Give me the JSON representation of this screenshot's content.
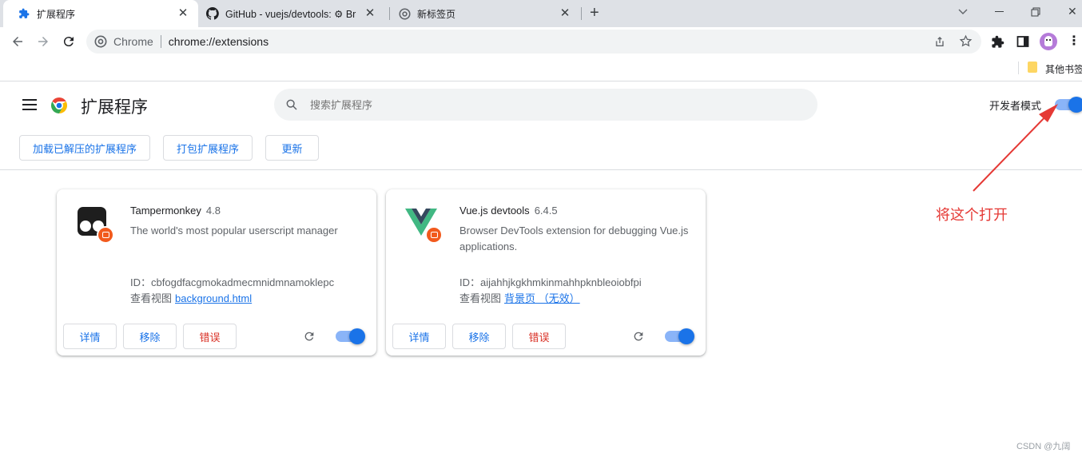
{
  "tabs": [
    {
      "title": "扩展程序",
      "icon": "puzzle-icon",
      "active": true
    },
    {
      "title": "GitHub - vuejs/devtools: ⚙ Br",
      "icon": "github-icon",
      "active": false
    },
    {
      "title": "新标签页",
      "icon": "chrome-icon",
      "active": false
    }
  ],
  "omnibox": {
    "site_label": "Chrome",
    "url": "chrome://extensions"
  },
  "bookmarks": {
    "other_label": "其他书签"
  },
  "header": {
    "title": "扩展程序",
    "search_placeholder": "搜索扩展程序",
    "dev_mode_label": "开发者模式",
    "dev_mode_on": true
  },
  "actions": {
    "load_unpacked": "加载已解压的扩展程序",
    "pack": "打包扩展程序",
    "update": "更新"
  },
  "extensions": [
    {
      "name": "Tampermonkey",
      "version": "4.8",
      "description": "The world's most popular userscript manager",
      "id_label": "ID：",
      "id": "cbfogdfacgmokadmecmnidmnamoklepc",
      "view_label": "查看视图",
      "view_link": "background.html",
      "details": "详情",
      "remove": "移除",
      "errors": "错误",
      "enabled": true
    },
    {
      "name": "Vue.js devtools",
      "version": "6.4.5",
      "description": "Browser DevTools extension for debugging Vue.js applications.",
      "id_label": "ID：",
      "id": "aijahhjkgkhmkinmahhpknbleoiobfpi",
      "view_label": "查看视图",
      "view_link": "背景页 （无效）",
      "details": "详情",
      "remove": "移除",
      "errors": "错误",
      "enabled": true
    }
  ],
  "annotation": {
    "text": "将这个打开",
    "color": "#e53935"
  },
  "watermark": "CSDN @九阔",
  "colors": {
    "accent": "#1a73e8",
    "error": "#d93025",
    "toggle_track": "#8ab4f8"
  }
}
